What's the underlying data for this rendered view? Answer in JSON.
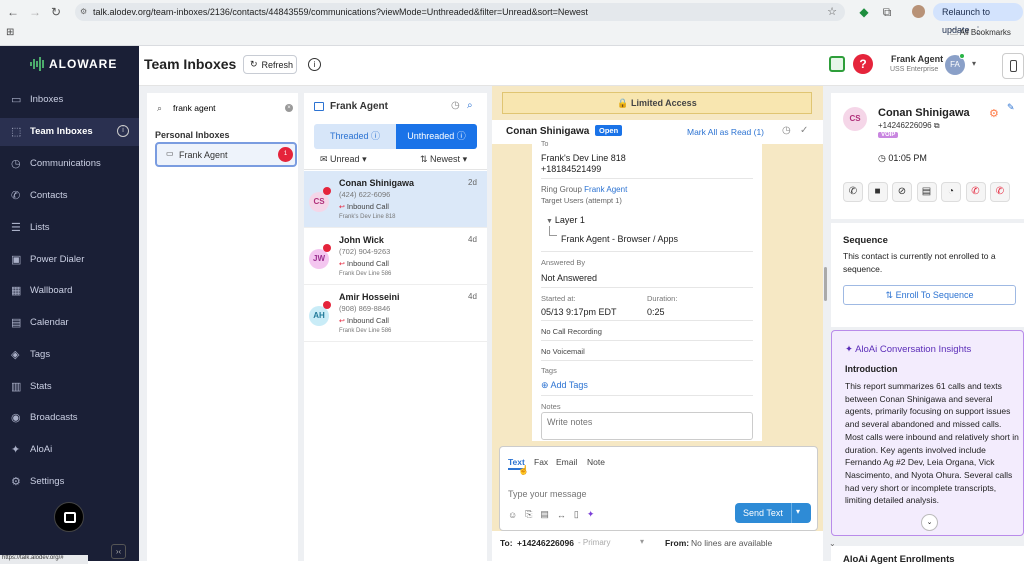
{
  "browser": {
    "url": "talk.alodev.org/team-inboxes/2136/contacts/44843559/communications?viewMode=Unthreaded&filter=Unread&sort=Newest",
    "relaunch_label": "Relaunch to update",
    "bookmarks_label": "All Bookmarks",
    "status_url": "https://talk.alodev.org/#"
  },
  "brand": {
    "logo_text": "ALOWARE"
  },
  "sidebar": {
    "items": [
      {
        "label": "Inboxes",
        "icon": "inbox-icon"
      },
      {
        "label": "Team Inboxes",
        "icon": "team-inbox-icon"
      },
      {
        "label": "Communications",
        "icon": "history-icon"
      },
      {
        "label": "Contacts",
        "icon": "phone-icon"
      },
      {
        "label": "Lists",
        "icon": "list-icon"
      },
      {
        "label": "Power Dialer",
        "icon": "power-dialer-icon"
      },
      {
        "label": "Wallboard",
        "icon": "wallboard-icon"
      },
      {
        "label": "Calendar",
        "icon": "calendar-icon"
      },
      {
        "label": "Tags",
        "icon": "tag-icon"
      },
      {
        "label": "Stats",
        "icon": "stats-icon"
      },
      {
        "label": "Broadcasts",
        "icon": "broadcast-icon"
      },
      {
        "label": "AloAi",
        "icon": "ai-icon"
      },
      {
        "label": "Settings",
        "icon": "gear-icon"
      }
    ]
  },
  "header": {
    "title": "Team Inboxes",
    "refresh_label": "Refresh",
    "user_name": "Frank Agent",
    "user_company": "USS Enterprise",
    "user_initials": "FA"
  },
  "inbox_search": {
    "value": "frank agent",
    "section_label": "Personal Inboxes",
    "inbox_name": "Frank Agent",
    "inbox_badge": "1"
  },
  "conversation_list": {
    "title": "Frank Agent",
    "tabs": {
      "threaded": "Threaded",
      "unthreaded": "Unthreaded"
    },
    "filter": "Unread",
    "sort": "Newest",
    "items": [
      {
        "initials": "CS",
        "name": "Conan Shinigawa",
        "phone": "(424) 622-6096",
        "type": "Inbound Call",
        "line": "Frank's Dev Line 818",
        "time": "2d",
        "avatar_bg": "#f5d6e8",
        "avatar_fg": "#b0307a"
      },
      {
        "initials": "JW",
        "name": "John Wick",
        "phone": "(702) 904-9263",
        "type": "Inbound Call",
        "line": "Frank Dev Line 586",
        "time": "4d",
        "avatar_bg": "#f4c6f0",
        "avatar_fg": "#9b2e8f"
      },
      {
        "initials": "AH",
        "name": "Amir Hosseini",
        "phone": "(908) 869-8846",
        "type": "Inbound Call",
        "line": "Frank Dev Line 586",
        "time": "4d",
        "avatar_bg": "#c9ecf7",
        "avatar_fg": "#227a99"
      }
    ]
  },
  "conversation": {
    "limited_access": "Limited Access",
    "contact_name": "Conan Shinigawa",
    "status": "Open",
    "mark_all_read": "Mark All as Read (1)",
    "to_label": "To",
    "to_line": "Frank's Dev Line 818",
    "to_number": "+18184521499",
    "ring_group_label": "Ring Group",
    "ring_group_value": "Frank Agent",
    "target_users": "Target Users (attempt 1)",
    "layer": "Layer 1",
    "layer_target": "Frank Agent - Browser / Apps",
    "answered_by_label": "Answered By",
    "answered_by_value": "Not Answered",
    "started_label": "Started at:",
    "started_value": "05/13 9:17pm EDT",
    "duration_label": "Duration:",
    "duration_value": "0:25",
    "recording": "No Call Recording",
    "voicemail": "No Voicemail",
    "tags_label": "Tags",
    "add_tags": "Add Tags",
    "notes_label": "Notes",
    "notes_placeholder": "Write notes"
  },
  "composer": {
    "tabs": [
      "Text",
      "Fax",
      "Email",
      "Note"
    ],
    "placeholder": "Type your message",
    "send_label": "Send Text",
    "to_label": "To:",
    "to_number": "+14246226096",
    "to_type": "- Primary",
    "from_label": "From:",
    "from_value": "No lines are available"
  },
  "contact": {
    "initials": "CS",
    "name": "Conan Shinigawa",
    "phone": "+14246226096",
    "badge": "VOIP",
    "time": "01:05 PM",
    "sequence_title": "Sequence",
    "sequence_text": "This contact is currently not enrolled to a sequence.",
    "enroll_label": "Enroll To Sequence",
    "insights_title": "AloAi Conversation Insights",
    "insights_heading": "Introduction",
    "insights_body": "This report summarizes 61 calls and texts between Conan Shinigawa and several agents, primarily focusing on support issues and several abandoned and missed calls. Most calls were inbound and relatively short in duration. Key agents involved include Fernando Ag #2 Dev, Leia Organa, Vick Nascimento, and Nyota Ohura. Several calls had very short or incomplete transcripts, limiting detailed analysis.",
    "next_section": "AloAi Agent Enrollments"
  },
  "colors": {
    "sidebar": "#1a1f36",
    "accent": "#1a73e8",
    "danger": "#e5243b",
    "limited_bg": "#fcf1cc"
  }
}
